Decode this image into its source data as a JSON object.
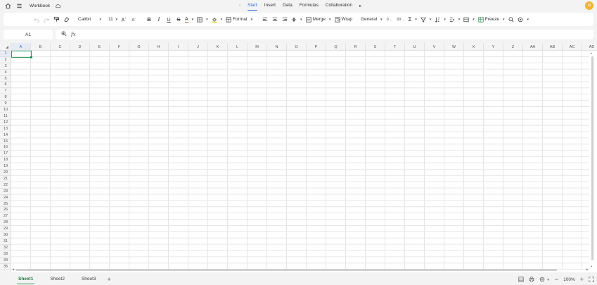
{
  "titlebar": {
    "home_icon": "home-icon",
    "menu_icon": "hamburger-icon",
    "title": "Workbook",
    "cloud_icon": "cloud-sync-icon",
    "tabs": [
      {
        "label": "Start",
        "active": true
      },
      {
        "label": "Insert",
        "active": false
      },
      {
        "label": "Data",
        "active": false
      },
      {
        "label": "Formulas",
        "active": false
      },
      {
        "label": "Collaboration",
        "active": false
      }
    ],
    "avatar_text": "U"
  },
  "toolbar": {
    "font_name": "Calibri",
    "font_size": "11",
    "format_label": "Format",
    "merge_label": "Merge",
    "wrap_label": "Wrap",
    "number_format": "General",
    "freeze_label": "Freeze"
  },
  "formula_bar": {
    "cell_ref": "A1",
    "fx_label": "fx",
    "value": ""
  },
  "grid": {
    "columns": [
      "A",
      "B",
      "C",
      "D",
      "E",
      "F",
      "G",
      "H",
      "I",
      "J",
      "K",
      "L",
      "M",
      "N",
      "O",
      "P",
      "Q",
      "R",
      "S",
      "T",
      "U",
      "V",
      "W",
      "X",
      "Y",
      "Z",
      "AA",
      "AB",
      "AC",
      "AD"
    ],
    "rows": [
      "1",
      "2",
      "3",
      "4",
      "5",
      "6",
      "7",
      "8",
      "9",
      "10",
      "11",
      "12",
      "13",
      "14",
      "15",
      "16",
      "17",
      "18",
      "19",
      "20",
      "21",
      "22",
      "23",
      "24",
      "25",
      "26",
      "27",
      "28",
      "29",
      "30",
      "31",
      "32",
      "33",
      "34",
      "35"
    ],
    "selected_column": "A",
    "selected_row": "1"
  },
  "sheets": [
    {
      "label": "Sheet1",
      "active": true
    },
    {
      "label": "Sheet2",
      "active": false
    },
    {
      "label": "Sheet3",
      "active": false
    }
  ],
  "status": {
    "zoom": "100%"
  },
  "colors": {
    "accent": "#2a6fdb",
    "active_cell": "#1f9d55",
    "avatar": "#f0b433"
  }
}
